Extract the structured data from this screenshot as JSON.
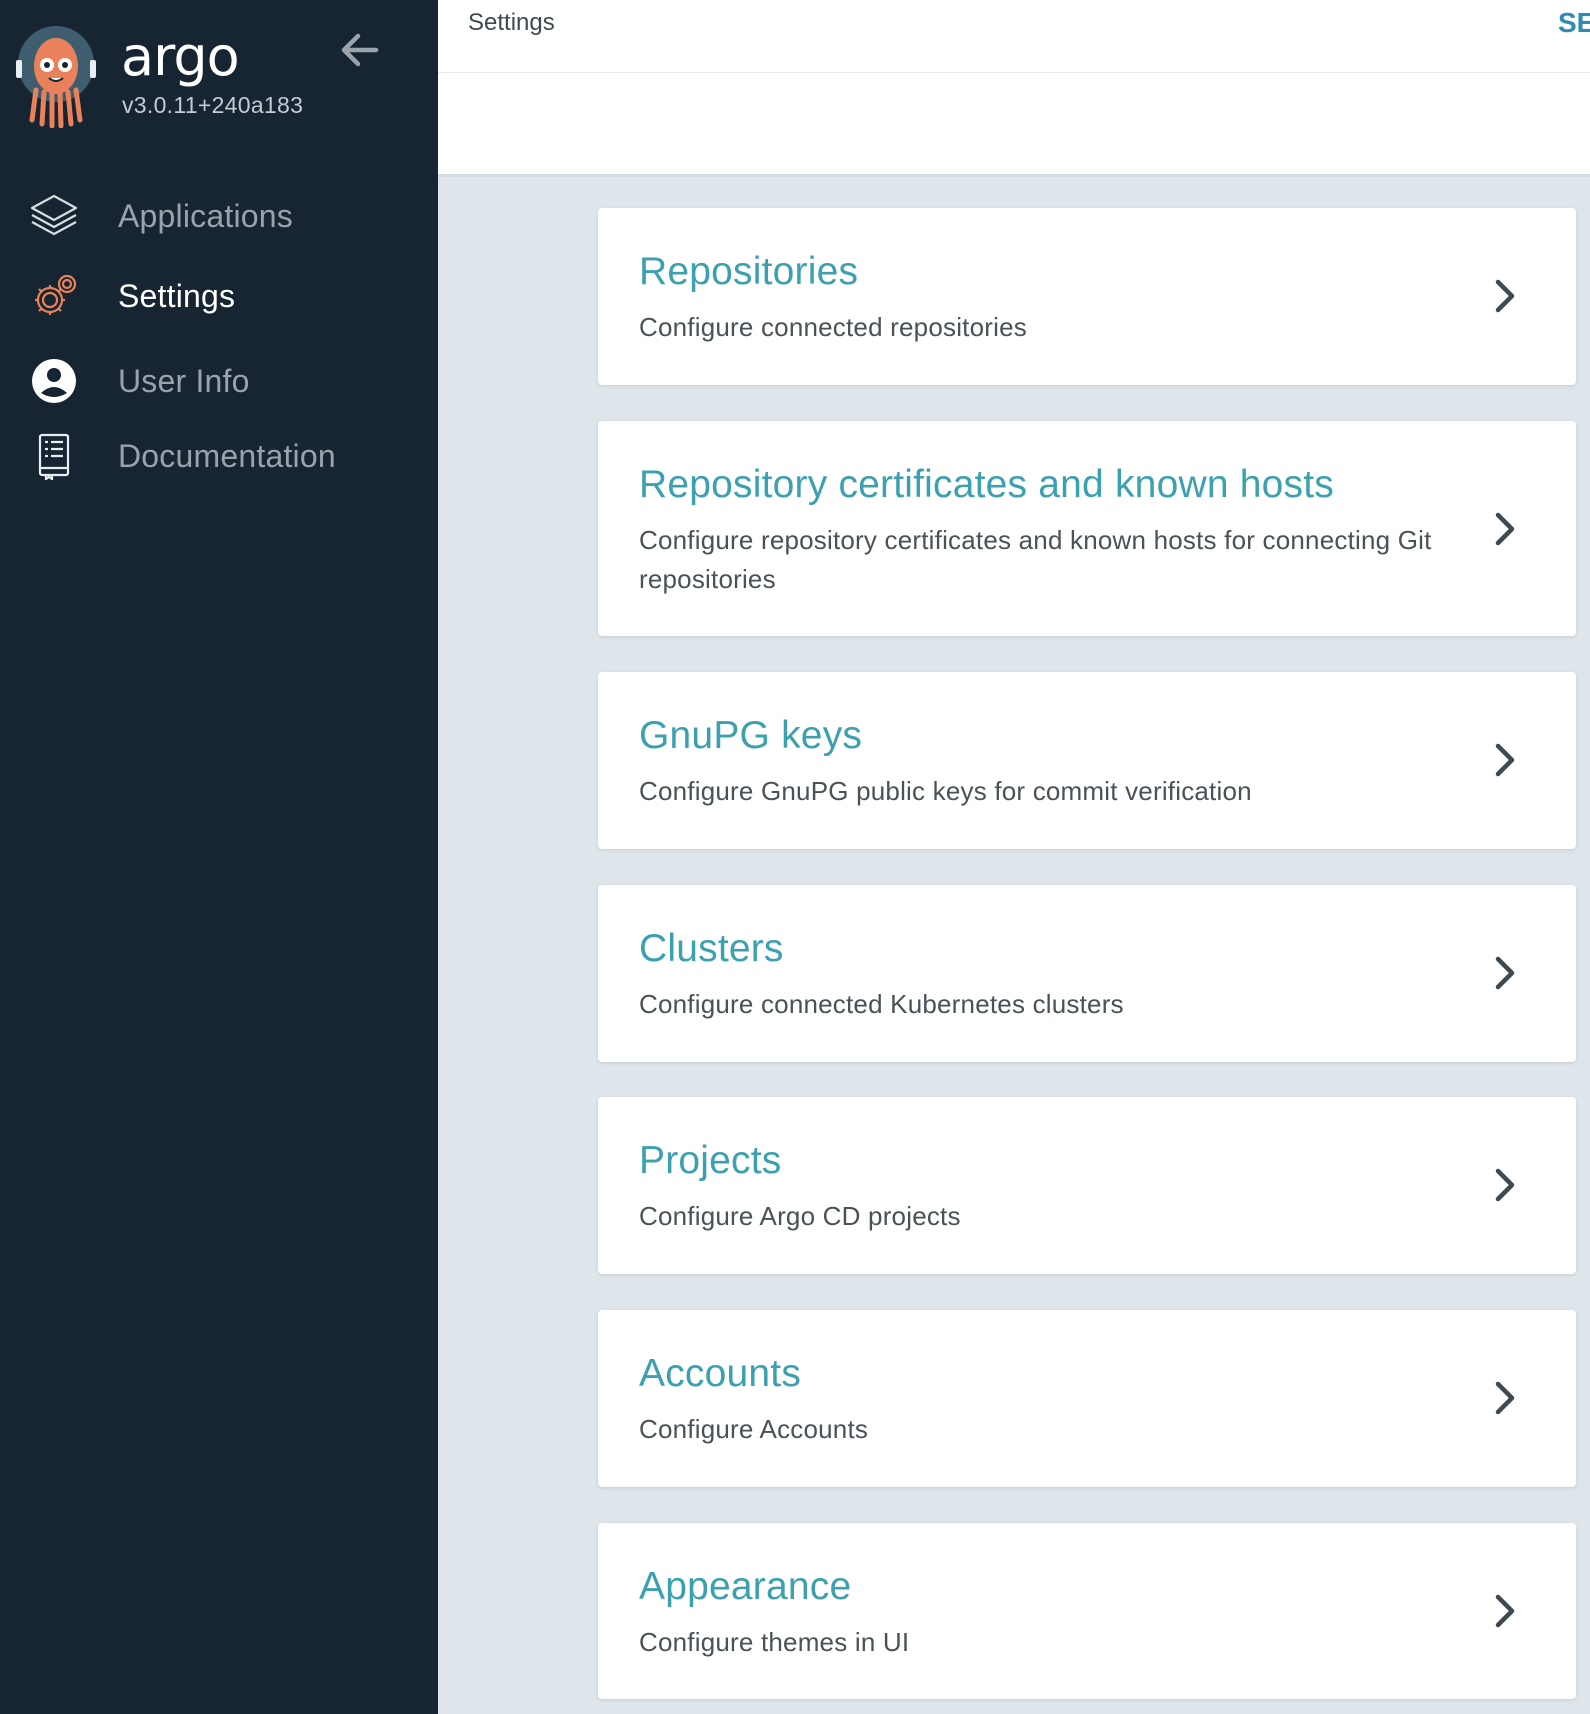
{
  "sidebar": {
    "logo_text": "argo",
    "version": "v3.0.11+240a183",
    "items": [
      {
        "label": "Applications",
        "icon": "layers-icon",
        "active": false
      },
      {
        "label": "Settings",
        "icon": "gears-icon",
        "active": true
      },
      {
        "label": "User Info",
        "icon": "user-circle-icon",
        "active": false
      },
      {
        "label": "Documentation",
        "icon": "book-icon",
        "active": false
      }
    ]
  },
  "header": {
    "title": "Settings",
    "action_label": "SE"
  },
  "cards": [
    {
      "title": "Repositories",
      "description": "Configure connected repositories"
    },
    {
      "title": "Repository certificates and known hosts",
      "description": "Configure repository certificates and known hosts for connecting Git repositories"
    },
    {
      "title": "GnuPG keys",
      "description": "Configure GnuPG public keys for commit verification"
    },
    {
      "title": "Clusters",
      "description": "Configure connected Kubernetes clusters"
    },
    {
      "title": "Projects",
      "description": "Configure Argo CD projects"
    },
    {
      "title": "Accounts",
      "description": "Configure Accounts"
    },
    {
      "title": "Appearance",
      "description": "Configure themes in UI"
    }
  ],
  "colors": {
    "sidebar_bg": "#172431",
    "accent_teal": "#3ca1ae",
    "mascot_orange": "#e9825a",
    "page_bg": "#dee6eb"
  }
}
